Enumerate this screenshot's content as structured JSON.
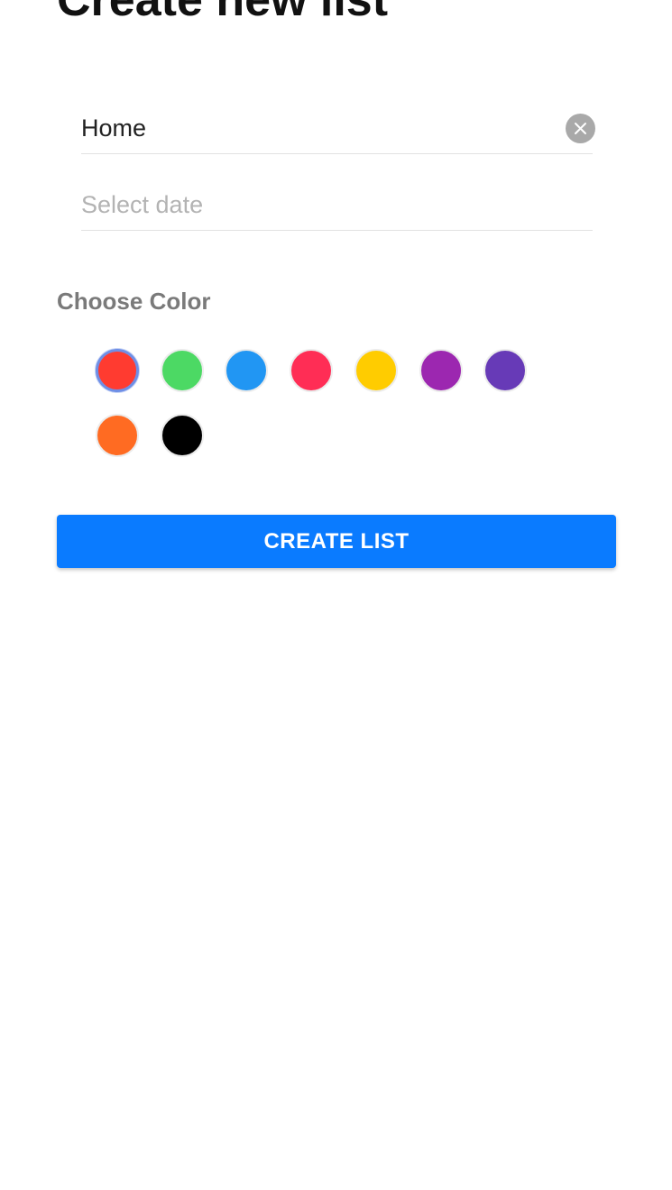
{
  "page": {
    "title": "Create new list"
  },
  "form": {
    "name_value": "Home",
    "name_clear_icon": "close-icon",
    "date_placeholder": "Select date"
  },
  "color_picker": {
    "label": "Choose Color",
    "selected_index": 0,
    "swatches": [
      {
        "name": "red",
        "color": "#ff3b30"
      },
      {
        "name": "green",
        "color": "#4cd964"
      },
      {
        "name": "blue",
        "color": "#2196f3"
      },
      {
        "name": "pink",
        "color": "#ff2d55"
      },
      {
        "name": "yellow",
        "color": "#ffcc00"
      },
      {
        "name": "purple",
        "color": "#9c27b0"
      },
      {
        "name": "deep-purple",
        "color": "#673ab7"
      },
      {
        "name": "orange",
        "color": "#ff6b22"
      },
      {
        "name": "black",
        "color": "#000000"
      }
    ]
  },
  "actions": {
    "create_label": "CREATE LIST",
    "accent_color": "#0a7bff"
  }
}
